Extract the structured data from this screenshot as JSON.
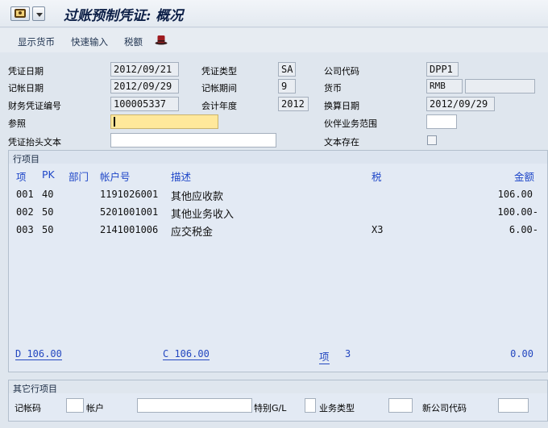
{
  "window": {
    "title": "过账预制凭证: 概况"
  },
  "toolbar": {
    "show_currency": "显示货币",
    "quick_entry": "快速输入",
    "tax": "税额"
  },
  "header": {
    "doc_date_label": "凭证日期",
    "doc_date": "2012/09/21",
    "doc_type_label": "凭证类型",
    "doc_type": "SA",
    "company_code_label": "公司代码",
    "company_code": "DPP1",
    "posting_date_label": "记帐日期",
    "posting_date": "2012/09/29",
    "period_label": "记帐期间",
    "period": "9",
    "currency_label": "货币",
    "currency": "RMB",
    "currency_extra": "",
    "doc_number_label": "财务凭证编号",
    "doc_number": "100005337",
    "fiscal_year_label": "会计年度",
    "fiscal_year": "2012",
    "translation_date_label": "换算日期",
    "translation_date": "2012/09/29",
    "reference_label": "参照",
    "reference": "",
    "trading_partner_label": "伙伴业务范围",
    "trading_partner": "",
    "header_text_label": "凭证抬头文本",
    "header_text": "",
    "text_exists_label": "文本存在",
    "text_exists": false
  },
  "line_items": {
    "section_title": "行项目",
    "columns": {
      "item": "项",
      "pk": "PK",
      "bus_area": "部门",
      "account": "帐户号",
      "description": "描述",
      "tax": "税",
      "amount": "金额"
    },
    "rows": [
      {
        "item": "001",
        "pk": "40",
        "account": "1191026001",
        "description": "其他应收款",
        "tax": "",
        "amount": "106.00"
      },
      {
        "item": "002",
        "pk": "50",
        "account": "5201001001",
        "description": "其他业务收入",
        "tax": "",
        "amount": "100.00-"
      },
      {
        "item": "003",
        "pk": "50",
        "account": "2141001006",
        "description": "应交税金",
        "tax": "X3",
        "amount": "6.00-"
      }
    ],
    "totals": {
      "debit": "D 106.00",
      "credit": "C 106.00",
      "items_label": "项",
      "items_count": "3",
      "balance": "0.00"
    }
  },
  "other_line_item": {
    "section_title": "其它行项目",
    "posting_key_label": "记帐码",
    "posting_key": "",
    "account_label": "帐户",
    "account": "",
    "special_gl_label": "特别G/L",
    "special_gl": "",
    "transaction_type_label": "业务类型",
    "transaction_type": "",
    "new_company_code_label": "新公司代码",
    "new_company_code": ""
  },
  "icons": {
    "app": "document-display-icon",
    "menu": "chevron-down-icon",
    "hat": "hat-icon"
  }
}
